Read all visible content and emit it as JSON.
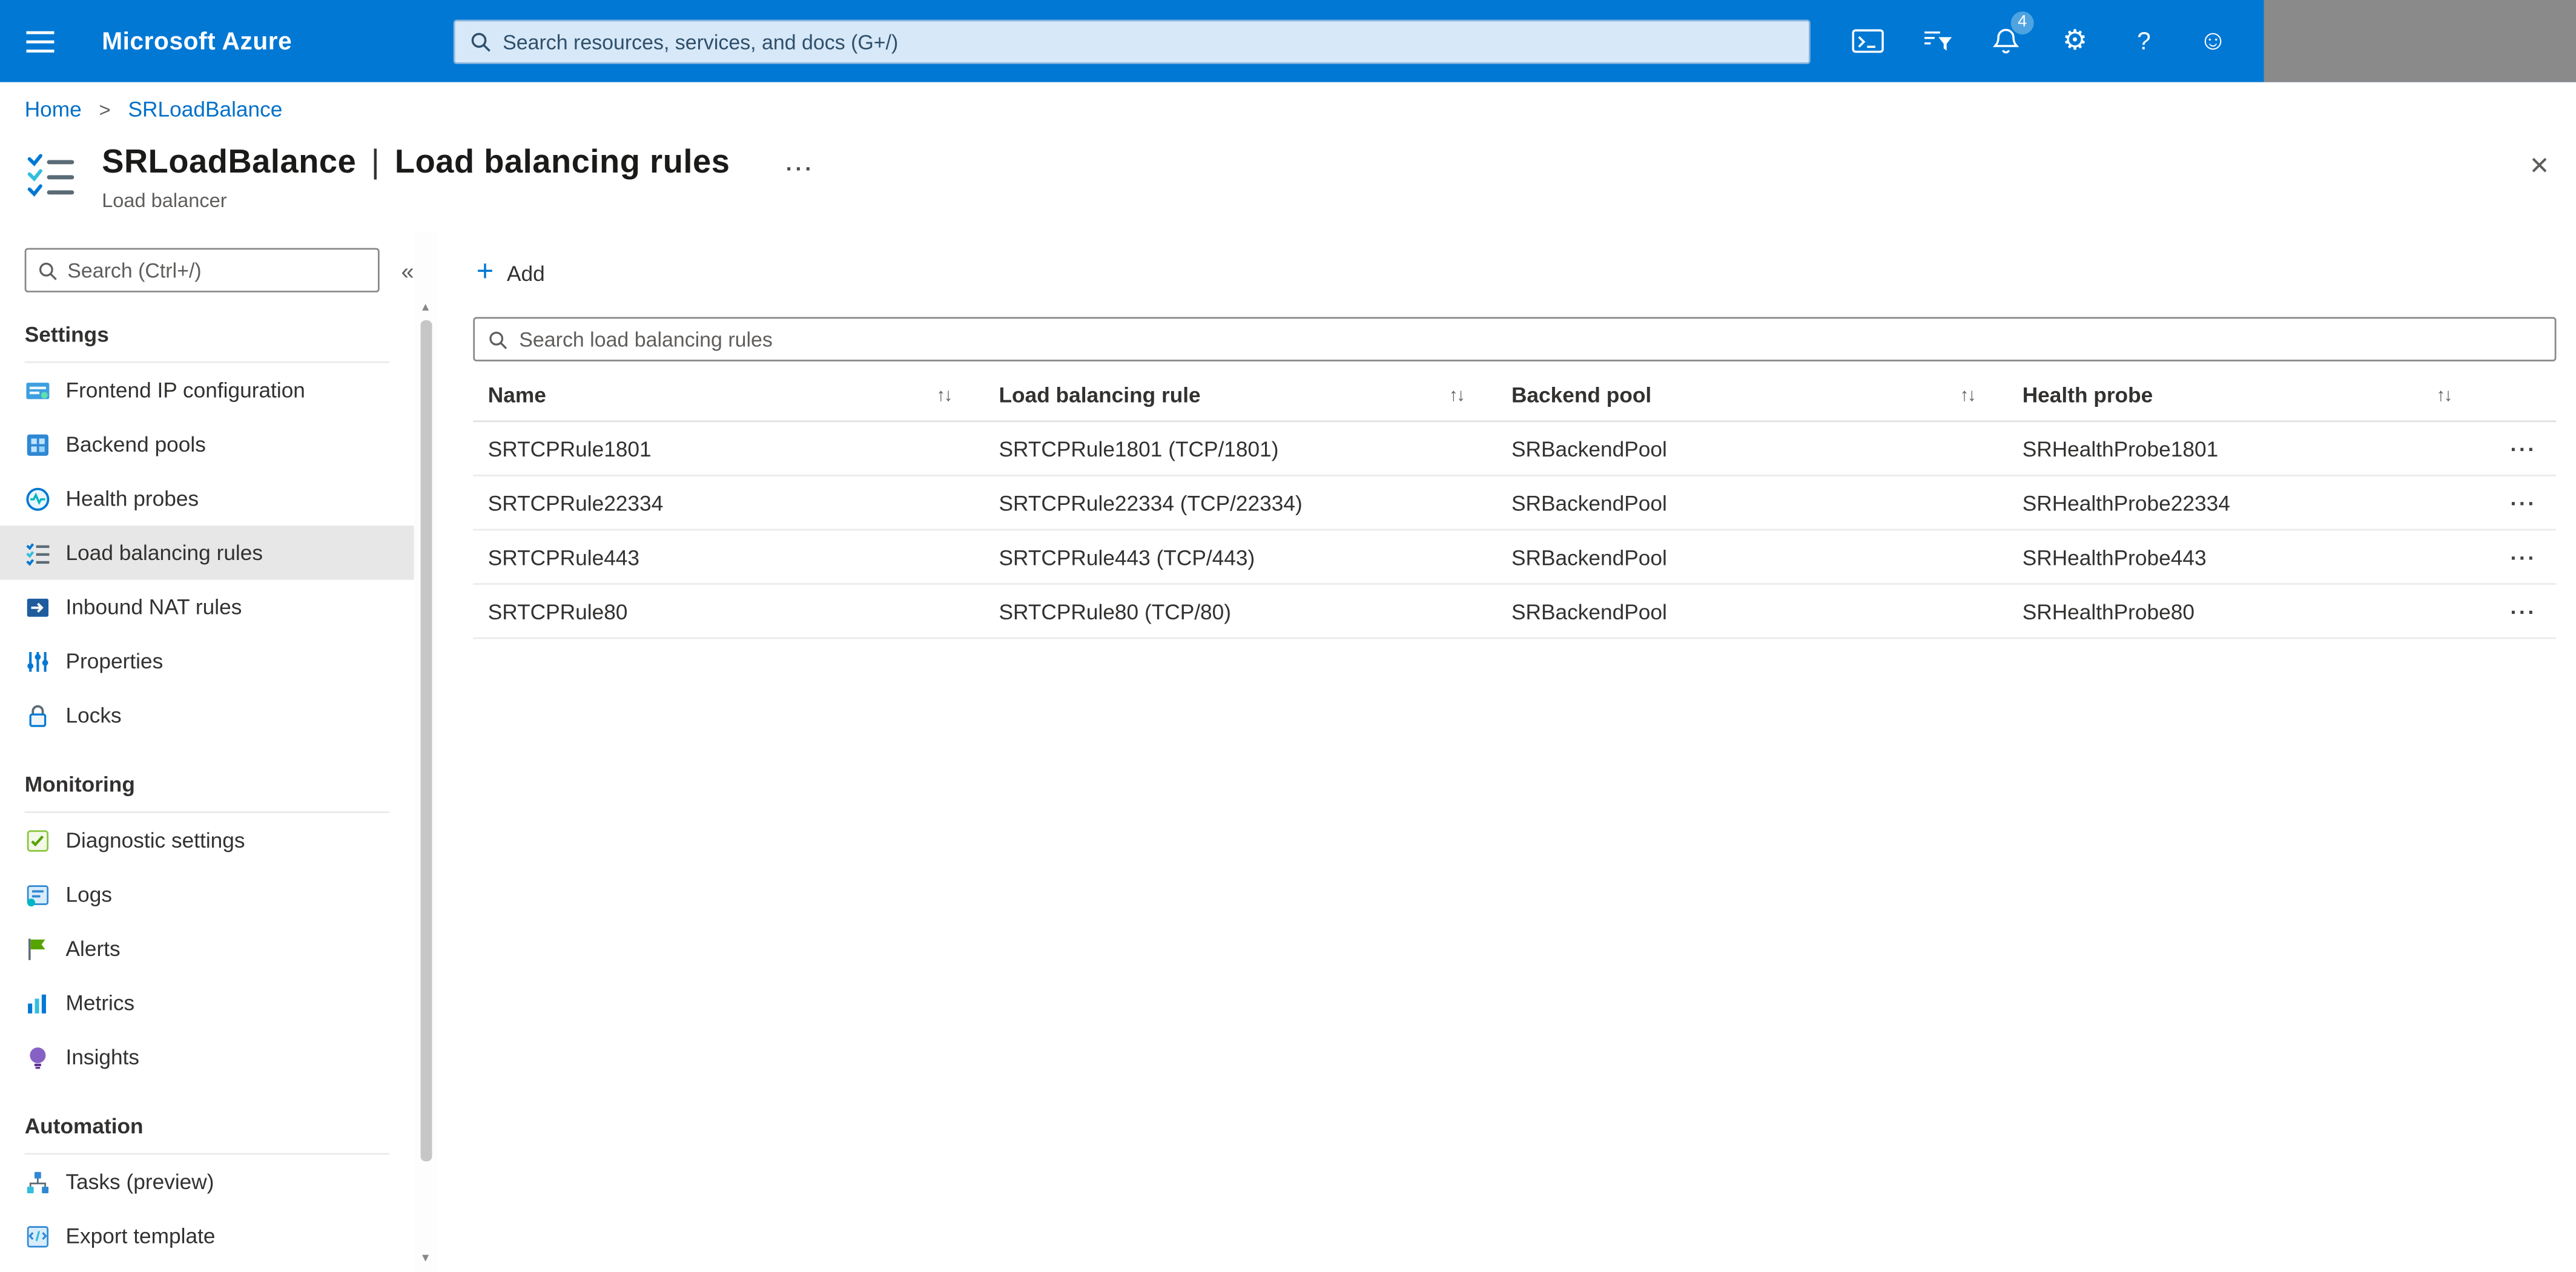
{
  "colors": {
    "brand": "#0078d4",
    "link": "#0070c9",
    "text": "#323130",
    "text-muted": "#605e5c",
    "selected-bg": "#e7e7e7",
    "row-border": "#edebe9",
    "badge-bg": "#4ea3e0",
    "account-block": "#8a8a8a",
    "topsearch-bg": "#d7e8f8",
    "topsearch-border": "#88b4dd",
    "topsearch-text": "#2f506b"
  },
  "topbar": {
    "brand": "Microsoft Azure",
    "search_placeholder": "Search resources, services, and docs (G+/)",
    "notification_count": "4",
    "gear_glyph": "⚙",
    "help_glyph": "?",
    "feedback_glyph": "☺"
  },
  "breadcrumb": {
    "separator": ">",
    "items": [
      {
        "label": "Home"
      },
      {
        "label": "SRLoadBalance"
      }
    ]
  },
  "page": {
    "title_primary": "SRLoadBalance",
    "title_separator": "|",
    "title_secondary": "Load balancing rules",
    "subtitle": "Load balancer",
    "more_glyph": "···",
    "close_glyph": "✕"
  },
  "sidebar": {
    "search_placeholder": "Search (Ctrl+/)",
    "collapse_glyph": "«",
    "sections": [
      {
        "title": "Settings",
        "items": [
          {
            "label": "Frontend IP configuration",
            "icon": "frontend-ip-icon",
            "selected": false
          },
          {
            "label": "Backend pools",
            "icon": "backend-pools-icon",
            "selected": false
          },
          {
            "label": "Health probes",
            "icon": "health-probes-icon",
            "selected": false
          },
          {
            "label": "Load balancing rules",
            "icon": "load-balancing-rules-icon",
            "selected": true
          },
          {
            "label": "Inbound NAT rules",
            "icon": "inbound-nat-rules-icon",
            "selected": false
          },
          {
            "label": "Properties",
            "icon": "properties-icon",
            "selected": false
          },
          {
            "label": "Locks",
            "icon": "locks-icon",
            "selected": false
          }
        ]
      },
      {
        "title": "Monitoring",
        "items": [
          {
            "label": "Diagnostic settings",
            "icon": "diagnostic-settings-icon",
            "selected": false
          },
          {
            "label": "Logs",
            "icon": "logs-icon",
            "selected": false
          },
          {
            "label": "Alerts",
            "icon": "alerts-icon",
            "selected": false
          },
          {
            "label": "Metrics",
            "icon": "metrics-icon",
            "selected": false
          },
          {
            "label": "Insights",
            "icon": "insights-icon",
            "selected": false
          }
        ]
      },
      {
        "title": "Automation",
        "items": [
          {
            "label": "Tasks (preview)",
            "icon": "tasks-icon",
            "selected": false
          },
          {
            "label": "Export template",
            "icon": "export-template-icon",
            "selected": false
          }
        ]
      }
    ]
  },
  "ui": {
    "scroll_up_glyph": "▲",
    "scroll_down_glyph": "▼"
  },
  "toolbar": {
    "add_label": "Add",
    "add_icon_glyph": "+"
  },
  "rules": {
    "search_placeholder": "Search load balancing rules",
    "sort_glyph": "↑↓",
    "row_actions_glyph": "···",
    "columns": [
      "Name",
      "Load balancing rule",
      "Backend pool",
      "Health probe"
    ],
    "rows": [
      {
        "name": "SRTCPRule1801",
        "rule": "SRTCPRule1801 (TCP/1801)",
        "backend_pool": "SRBackendPool",
        "health_probe": "SRHealthProbe1801"
      },
      {
        "name": "SRTCPRule22334",
        "rule": "SRTCPRule22334 (TCP/22334)",
        "backend_pool": "SRBackendPool",
        "health_probe": "SRHealthProbe22334"
      },
      {
        "name": "SRTCPRule443",
        "rule": "SRTCPRule443 (TCP/443)",
        "backend_pool": "SRBackendPool",
        "health_probe": "SRHealthProbe443"
      },
      {
        "name": "SRTCPRule80",
        "rule": "SRTCPRule80 (TCP/80)",
        "backend_pool": "SRBackendPool",
        "health_probe": "SRHealthProbe80"
      }
    ]
  }
}
